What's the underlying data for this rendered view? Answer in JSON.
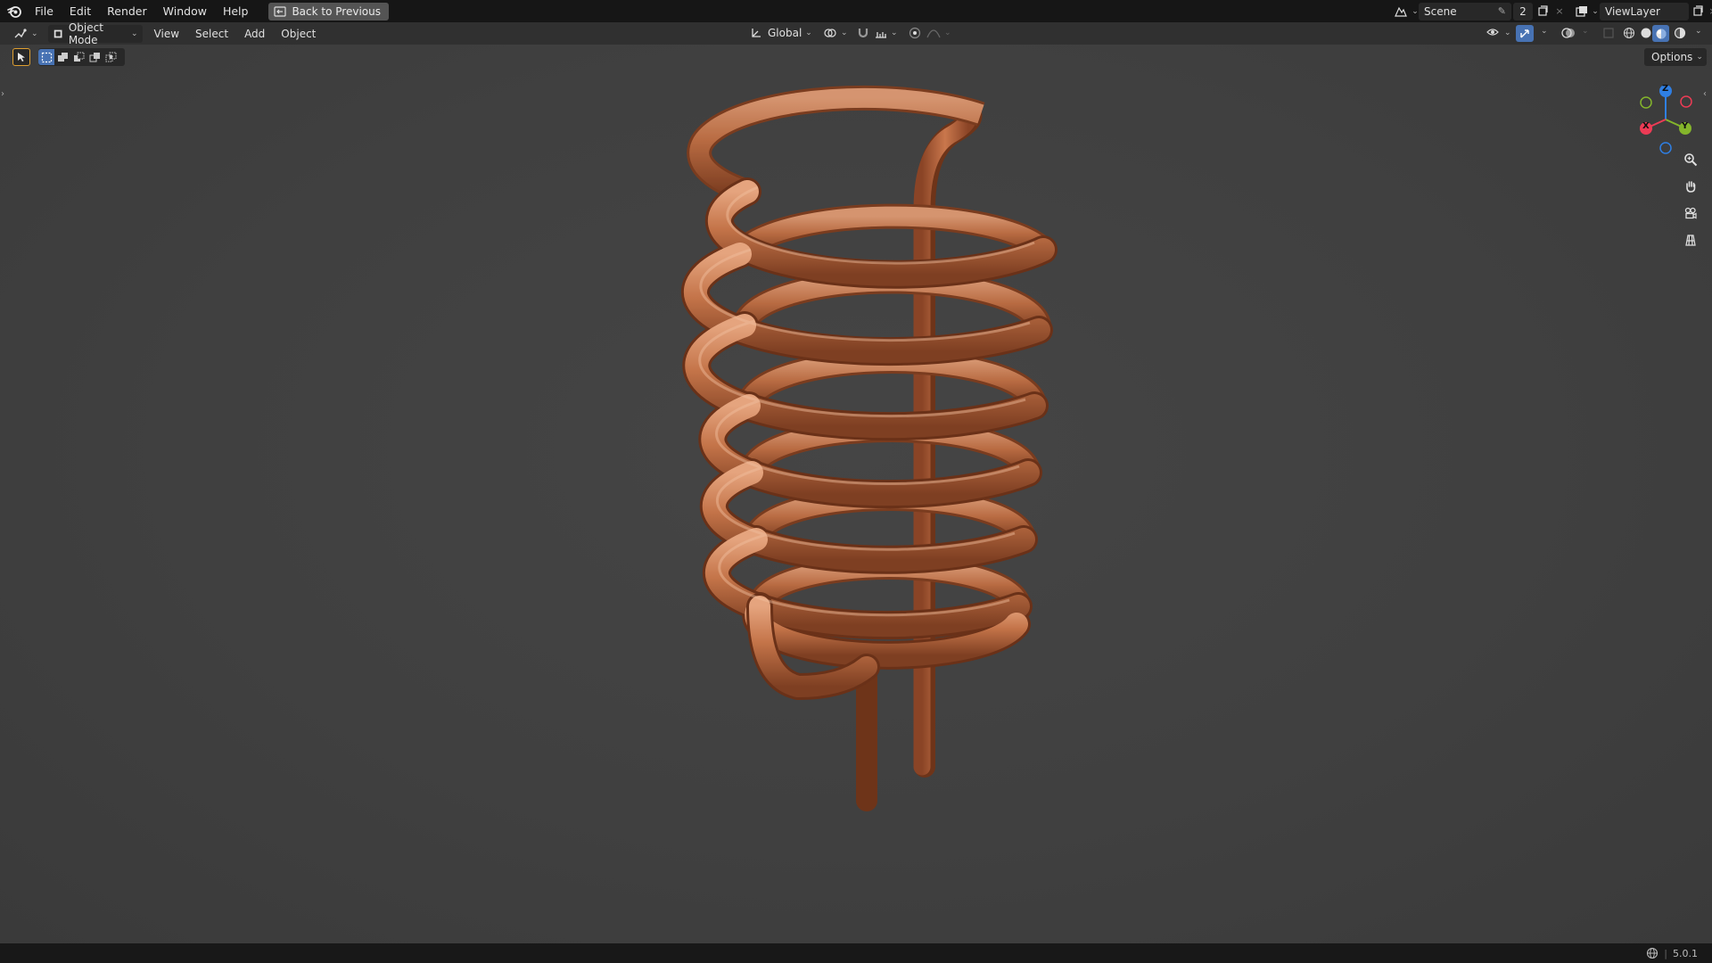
{
  "topbar": {
    "menus": [
      "File",
      "Edit",
      "Render",
      "Window",
      "Help"
    ],
    "back_button": "Back to Previous",
    "scene_name": "Scene",
    "scene_users": "2",
    "view_layer": "ViewLayer"
  },
  "header": {
    "mode": "Object Mode",
    "menus": [
      "View",
      "Select",
      "Add",
      "Object"
    ],
    "transform_orientation": "Global",
    "options": "Options"
  },
  "gizmo": {
    "axes": {
      "x": "X",
      "y": "Y",
      "z": "Z"
    },
    "colors": {
      "x": "#ed3b55",
      "y": "#84b52b",
      "z": "#2f7fe3"
    }
  },
  "viewport": {
    "object": "copper helical coil",
    "object_color": "#c9774c",
    "background_color": "#404040"
  },
  "statusbar": {
    "version": "5.0.1"
  }
}
